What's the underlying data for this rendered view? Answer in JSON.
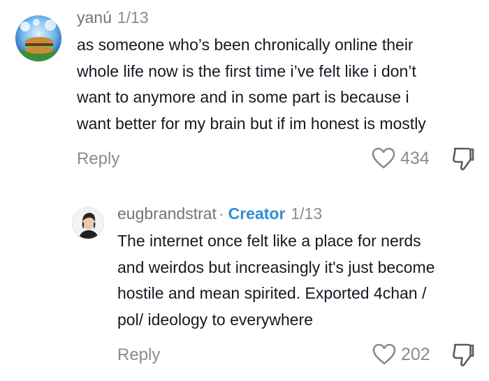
{
  "comments": [
    {
      "username": "yanú",
      "date": "1/13",
      "lines": [
        "as someone who’s been chronically online their",
        "whole life now is the first time i’ve felt like i don’t",
        "want to anymore and in some part is because i",
        "want better for my brain but if im honest is mostly"
      ],
      "reply_label": "Reply",
      "like_count": "434",
      "icons": {
        "like": "heart-outline-icon",
        "dislike": "thumbs-down-icon"
      }
    },
    {
      "username": "eugbrandstrat",
      "separator": "·",
      "badge": "Creator",
      "date": "1/13",
      "lines": [
        "The internet once felt like a place for nerds",
        "and weirdos but increasingly it's just become",
        "hostile and mean spirited. Exported 4chan /",
        "pol/ ideology to everywhere"
      ],
      "reply_label": "Reply",
      "like_count": "202",
      "icons": {
        "like": "heart-outline-icon",
        "dislike": "thumbs-down-icon"
      }
    }
  ],
  "colors": {
    "creator_badge": "#2e8fd6",
    "meta_text": "#8a8b91",
    "body_text": "#161823"
  }
}
